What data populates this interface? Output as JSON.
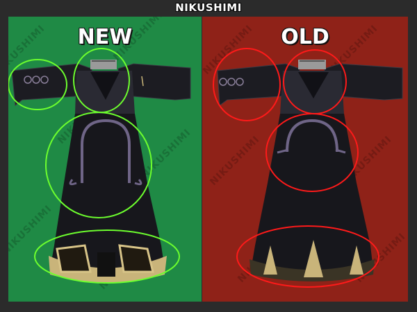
{
  "header": {
    "title": "NIKUSHIMI"
  },
  "panels": {
    "new": {
      "label": "NEW",
      "bg_color": "#1f8a45",
      "circle_color": "#6dff2e"
    },
    "old": {
      "label": "OLD",
      "bg_color": "#8f2218",
      "circle_color": "#ff1a1a"
    }
  },
  "watermark": {
    "text": "NIKUSHIMI"
  }
}
